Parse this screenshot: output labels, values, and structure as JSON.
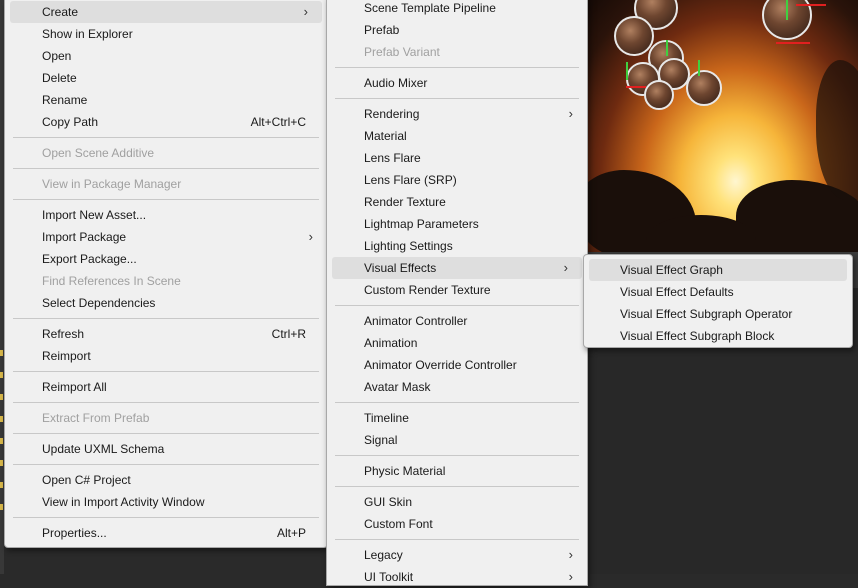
{
  "menu_main": {
    "items": [
      {
        "label": "Create",
        "submenu": true,
        "highlighted": true
      },
      {
        "label": "Show in Explorer"
      },
      {
        "label": "Open"
      },
      {
        "label": "Delete"
      },
      {
        "label": "Rename"
      },
      {
        "label": "Copy Path",
        "shortcut": "Alt+Ctrl+C"
      },
      {
        "separator": true
      },
      {
        "label": "Open Scene Additive",
        "disabled": true
      },
      {
        "separator": true
      },
      {
        "label": "View in Package Manager",
        "disabled": true
      },
      {
        "separator": true
      },
      {
        "label": "Import New Asset..."
      },
      {
        "label": "Import Package",
        "submenu": true
      },
      {
        "label": "Export Package..."
      },
      {
        "label": "Find References In Scene",
        "disabled": true
      },
      {
        "label": "Select Dependencies"
      },
      {
        "separator": true
      },
      {
        "label": "Refresh",
        "shortcut": "Ctrl+R"
      },
      {
        "label": "Reimport"
      },
      {
        "separator": true
      },
      {
        "label": "Reimport All"
      },
      {
        "separator": true
      },
      {
        "label": "Extract From Prefab",
        "disabled": true
      },
      {
        "separator": true
      },
      {
        "label": "Update UXML Schema"
      },
      {
        "separator": true
      },
      {
        "label": "Open C# Project"
      },
      {
        "label": "View in Import Activity Window"
      },
      {
        "separator": true
      },
      {
        "label": "Properties...",
        "shortcut": "Alt+P"
      }
    ]
  },
  "menu_create": {
    "items": [
      {
        "label": "Scene Template Pipeline"
      },
      {
        "label": "Prefab"
      },
      {
        "label": "Prefab Variant",
        "disabled": true
      },
      {
        "separator": true
      },
      {
        "label": "Audio Mixer"
      },
      {
        "separator": true
      },
      {
        "label": "Rendering",
        "submenu": true
      },
      {
        "label": "Material"
      },
      {
        "label": "Lens Flare"
      },
      {
        "label": "Lens Flare (SRP)"
      },
      {
        "label": "Render Texture"
      },
      {
        "label": "Lightmap Parameters"
      },
      {
        "label": "Lighting Settings"
      },
      {
        "label": "Visual Effects",
        "submenu": true,
        "highlighted": true
      },
      {
        "label": "Custom Render Texture"
      },
      {
        "separator": true
      },
      {
        "label": "Animator Controller"
      },
      {
        "label": "Animation"
      },
      {
        "label": "Animator Override Controller"
      },
      {
        "label": "Avatar Mask"
      },
      {
        "separator": true
      },
      {
        "label": "Timeline"
      },
      {
        "label": "Signal"
      },
      {
        "separator": true
      },
      {
        "label": "Physic Material"
      },
      {
        "separator": true
      },
      {
        "label": "GUI Skin"
      },
      {
        "label": "Custom Font"
      },
      {
        "separator": true
      },
      {
        "label": "Legacy",
        "submenu": true
      },
      {
        "label": "UI Toolkit",
        "submenu": true
      }
    ]
  },
  "menu_vfx": {
    "items": [
      {
        "label": "Visual Effect Graph",
        "highlighted": true
      },
      {
        "label": "Visual Effect Defaults"
      },
      {
        "label": "Visual Effect Subgraph Operator"
      },
      {
        "label": "Visual Effect Subgraph Block"
      }
    ]
  },
  "icons": {
    "submenu_arrow": "›"
  },
  "colors": {
    "menu_bg": "#f0f0f0",
    "highlight": "#dedede",
    "disabled_text": "#a0a0a0"
  }
}
